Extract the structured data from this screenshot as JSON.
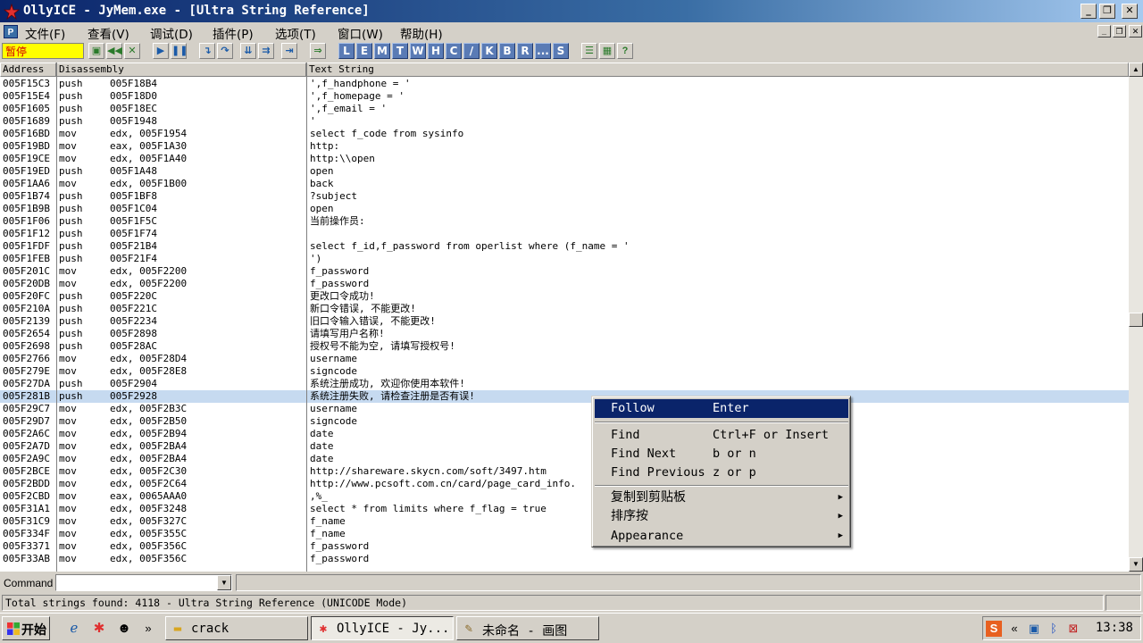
{
  "window": {
    "title": "OllyICE - JyMem.exe - [Ultra String Reference]",
    "controls": {
      "minimize": "_",
      "restore": "❐",
      "close": "✕"
    }
  },
  "menu": [
    {
      "label": "文件(F)"
    },
    {
      "label": "查看(V)"
    },
    {
      "label": "调试(D)"
    },
    {
      "label": "插件(P)"
    },
    {
      "label": "选项(T)"
    },
    {
      "label": "窗口(W)"
    },
    {
      "label": "帮助(H)"
    }
  ],
  "toolbar": {
    "status": "暂停",
    "letter_buttons": [
      "L",
      "E",
      "M",
      "T",
      "W",
      "H",
      "C",
      "/",
      "K",
      "B",
      "R",
      "...",
      "S"
    ]
  },
  "table": {
    "columns": [
      "Address",
      "Disassembly",
      "Text String"
    ],
    "rows": [
      {
        "addr": "005F15C3",
        "op": "push",
        "arg": "005F18B4",
        "text": "',f_handphone = '"
      },
      {
        "addr": "005F15E4",
        "op": "push",
        "arg": "005F18D0",
        "text": "',f_homepage = '"
      },
      {
        "addr": "005F1605",
        "op": "push",
        "arg": "005F18EC",
        "text": "',f_email = '"
      },
      {
        "addr": "005F1689",
        "op": "push",
        "arg": "005F1948",
        "text": "'"
      },
      {
        "addr": "005F16BD",
        "op": "mov",
        "arg": "edx, 005F1954",
        "text": "select f_code from sysinfo"
      },
      {
        "addr": "005F19BD",
        "op": "mov",
        "arg": "eax, 005F1A30",
        "text": "http:"
      },
      {
        "addr": "005F19CE",
        "op": "mov",
        "arg": "edx, 005F1A40",
        "text": "http:\\\\open"
      },
      {
        "addr": "005F19ED",
        "op": "push",
        "arg": "005F1A48",
        "text": "open"
      },
      {
        "addr": "005F1AA6",
        "op": "mov",
        "arg": "edx, 005F1B00",
        "text": "back"
      },
      {
        "addr": "005F1B74",
        "op": "push",
        "arg": "005F1BF8",
        "text": "?subject"
      },
      {
        "addr": "005F1B9B",
        "op": "push",
        "arg": "005F1C04",
        "text": "open"
      },
      {
        "addr": "005F1F06",
        "op": "push",
        "arg": "005F1F5C",
        "text": "当前操作员:"
      },
      {
        "addr": "005F1F12",
        "op": "push",
        "arg": "005F1F74",
        "text": ""
      },
      {
        "addr": "005F1FDF",
        "op": "push",
        "arg": "005F21B4",
        "text": "select f_id,f_password from operlist where (f_name = '"
      },
      {
        "addr": "005F1FEB",
        "op": "push",
        "arg": "005F21F4",
        "text": "')"
      },
      {
        "addr": "005F201C",
        "op": "mov",
        "arg": "edx, 005F2200",
        "text": "f_password"
      },
      {
        "addr": "005F20DB",
        "op": "mov",
        "arg": "edx, 005F2200",
        "text": "f_password"
      },
      {
        "addr": "005F20FC",
        "op": "push",
        "arg": "005F220C",
        "text": "更改口令成功!"
      },
      {
        "addr": "005F210A",
        "op": "push",
        "arg": "005F221C",
        "text": "新口令错误, 不能更改!"
      },
      {
        "addr": "005F2139",
        "op": "push",
        "arg": "005F2234",
        "text": "旧口令输入错误, 不能更改!"
      },
      {
        "addr": "005F2654",
        "op": "push",
        "arg": "005F2898",
        "text": "请填写用户名称!"
      },
      {
        "addr": "005F2698",
        "op": "push",
        "arg": "005F28AC",
        "text": "授权号不能为空, 请填写授权号!"
      },
      {
        "addr": "005F2766",
        "op": "mov",
        "arg": "edx, 005F28D4",
        "text": "username"
      },
      {
        "addr": "005F279E",
        "op": "mov",
        "arg": "edx, 005F28E8",
        "text": "signcode"
      },
      {
        "addr": "005F27DA",
        "op": "push",
        "arg": "005F2904",
        "text": "系统注册成功, 欢迎你使用本软件!"
      },
      {
        "addr": "005F281B",
        "op": "push",
        "arg": "005F2928",
        "text": "系统注册失败, 请检查注册是否有误!"
      },
      {
        "addr": "005F29C7",
        "op": "mov",
        "arg": "edx, 005F2B3C",
        "text": "username"
      },
      {
        "addr": "005F29D7",
        "op": "mov",
        "arg": "edx, 005F2B50",
        "text": "signcode"
      },
      {
        "addr": "005F2A6C",
        "op": "mov",
        "arg": "edx, 005F2B94",
        "text": "date"
      },
      {
        "addr": "005F2A7D",
        "op": "mov",
        "arg": "edx, 005F2BA4",
        "text": "date"
      },
      {
        "addr": "005F2A9C",
        "op": "mov",
        "arg": "edx, 005F2BA4",
        "text": "date"
      },
      {
        "addr": "005F2BCE",
        "op": "mov",
        "arg": "edx, 005F2C30",
        "text": "http://shareware.skycn.com/soft/3497.htm"
      },
      {
        "addr": "005F2BDD",
        "op": "mov",
        "arg": "edx, 005F2C64",
        "text": "http://www.pcsoft.com.cn/card/page_card_info."
      },
      {
        "addr": "005F2CBD",
        "op": "mov",
        "arg": "eax, 0065AAA0",
        "text": ",%_"
      },
      {
        "addr": "005F31A1",
        "op": "mov",
        "arg": "edx, 005F3248",
        "text": "select * from limits where f_flag = true"
      },
      {
        "addr": "005F31C9",
        "op": "mov",
        "arg": "edx, 005F327C",
        "text": "f_name"
      },
      {
        "addr": "005F334F",
        "op": "mov",
        "arg": "edx, 005F355C",
        "text": "f_name"
      },
      {
        "addr": "005F3371",
        "op": "mov",
        "arg": "edx, 005F356C",
        "text": "f_password"
      },
      {
        "addr": "005F33AB",
        "op": "mov",
        "arg": "edx, 005F356C",
        "text": "f_password"
      }
    ],
    "selected_address": "005F281B"
  },
  "context_menu": {
    "items": [
      {
        "label": "Follow",
        "shortcut": "Enter",
        "highlighted": true
      },
      {
        "label": "Find",
        "shortcut": "Ctrl+F or Insert"
      },
      {
        "label": "Find Next",
        "shortcut": "b or n"
      },
      {
        "label": "Find Previous",
        "shortcut": "z or p"
      },
      {
        "label": "复制到剪贴板",
        "submenu": true
      },
      {
        "label": "排序按",
        "submenu": true
      },
      {
        "label": "Appearance",
        "submenu": true
      }
    ]
  },
  "command_bar": {
    "label": "Command",
    "value": ""
  },
  "status_bar": {
    "text": "Total strings found: 4118  -  Ultra String Reference (UNICODE Mode)"
  },
  "taskbar": {
    "start_label": "开始",
    "tasks": [
      {
        "label": "crack",
        "icon": "folder-icon"
      },
      {
        "label": "OllyICE - Jy...",
        "icon": "ollyice-icon",
        "active": true
      },
      {
        "label": "未命名 - 画图",
        "icon": "paint-icon"
      }
    ],
    "chevron": "»",
    "tray_chevron": "«",
    "clock": "13:38"
  },
  "colors": {
    "titlebar_start": "#0a246a",
    "selection": "#c6daf0",
    "menu_highlight": "#0a246a",
    "pause_bg": "#ffff00",
    "pause_fg": "#d40000"
  }
}
